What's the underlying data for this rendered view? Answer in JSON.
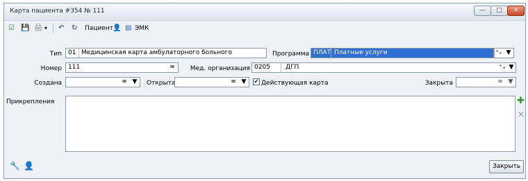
{
  "window": {
    "title": "Карта пациента #354 № 111",
    "buttons": {
      "minimize": "—",
      "maximize": "□",
      "close": "✕"
    }
  },
  "toolbar": {
    "check_icon": "☑",
    "save_icon": "💾",
    "print_icon": "🖨",
    "print_arrow": "▾",
    "undo_icon": "↶",
    "refresh_icon": "↻",
    "patient_label": "Пациент",
    "patient_icon": "👤",
    "emk_icon": "▤",
    "emk_label": "ЭМК"
  },
  "form": {
    "type": {
      "label": "Тип",
      "code": "01",
      "value": "Медицинская карта амбулаторного больного"
    },
    "program": {
      "label": "Программа",
      "code": "ПЛАТ",
      "value": "Платные услуги",
      "plus": "⁺₊",
      "arrow": "▼"
    },
    "number": {
      "label": "Номер",
      "value": "111",
      "eq": "="
    },
    "med_org": {
      "label": "Мед. организация",
      "code": "0205",
      "value": "ДГП",
      "plus": "⁺₊",
      "arrow": "▼"
    },
    "created": {
      "label": "Создана",
      "value": "",
      "eq": "=",
      "arrow": "▼"
    },
    "opened": {
      "label": "Открыта",
      "value": "",
      "eq": "=",
      "arrow": "▼"
    },
    "active_card": {
      "label": "Действующая карта",
      "checked": true,
      "mark": "✔"
    },
    "closed": {
      "label": "Закрыта",
      "value": "",
      "eq": "=",
      "arrow": "▼"
    },
    "attachments": {
      "label": "Прикрепления",
      "add_icon": "✚",
      "remove_icon": "✕"
    }
  },
  "footer": {
    "icon1": "🔧",
    "icon2": "👤",
    "close_label": "Закрыть"
  }
}
